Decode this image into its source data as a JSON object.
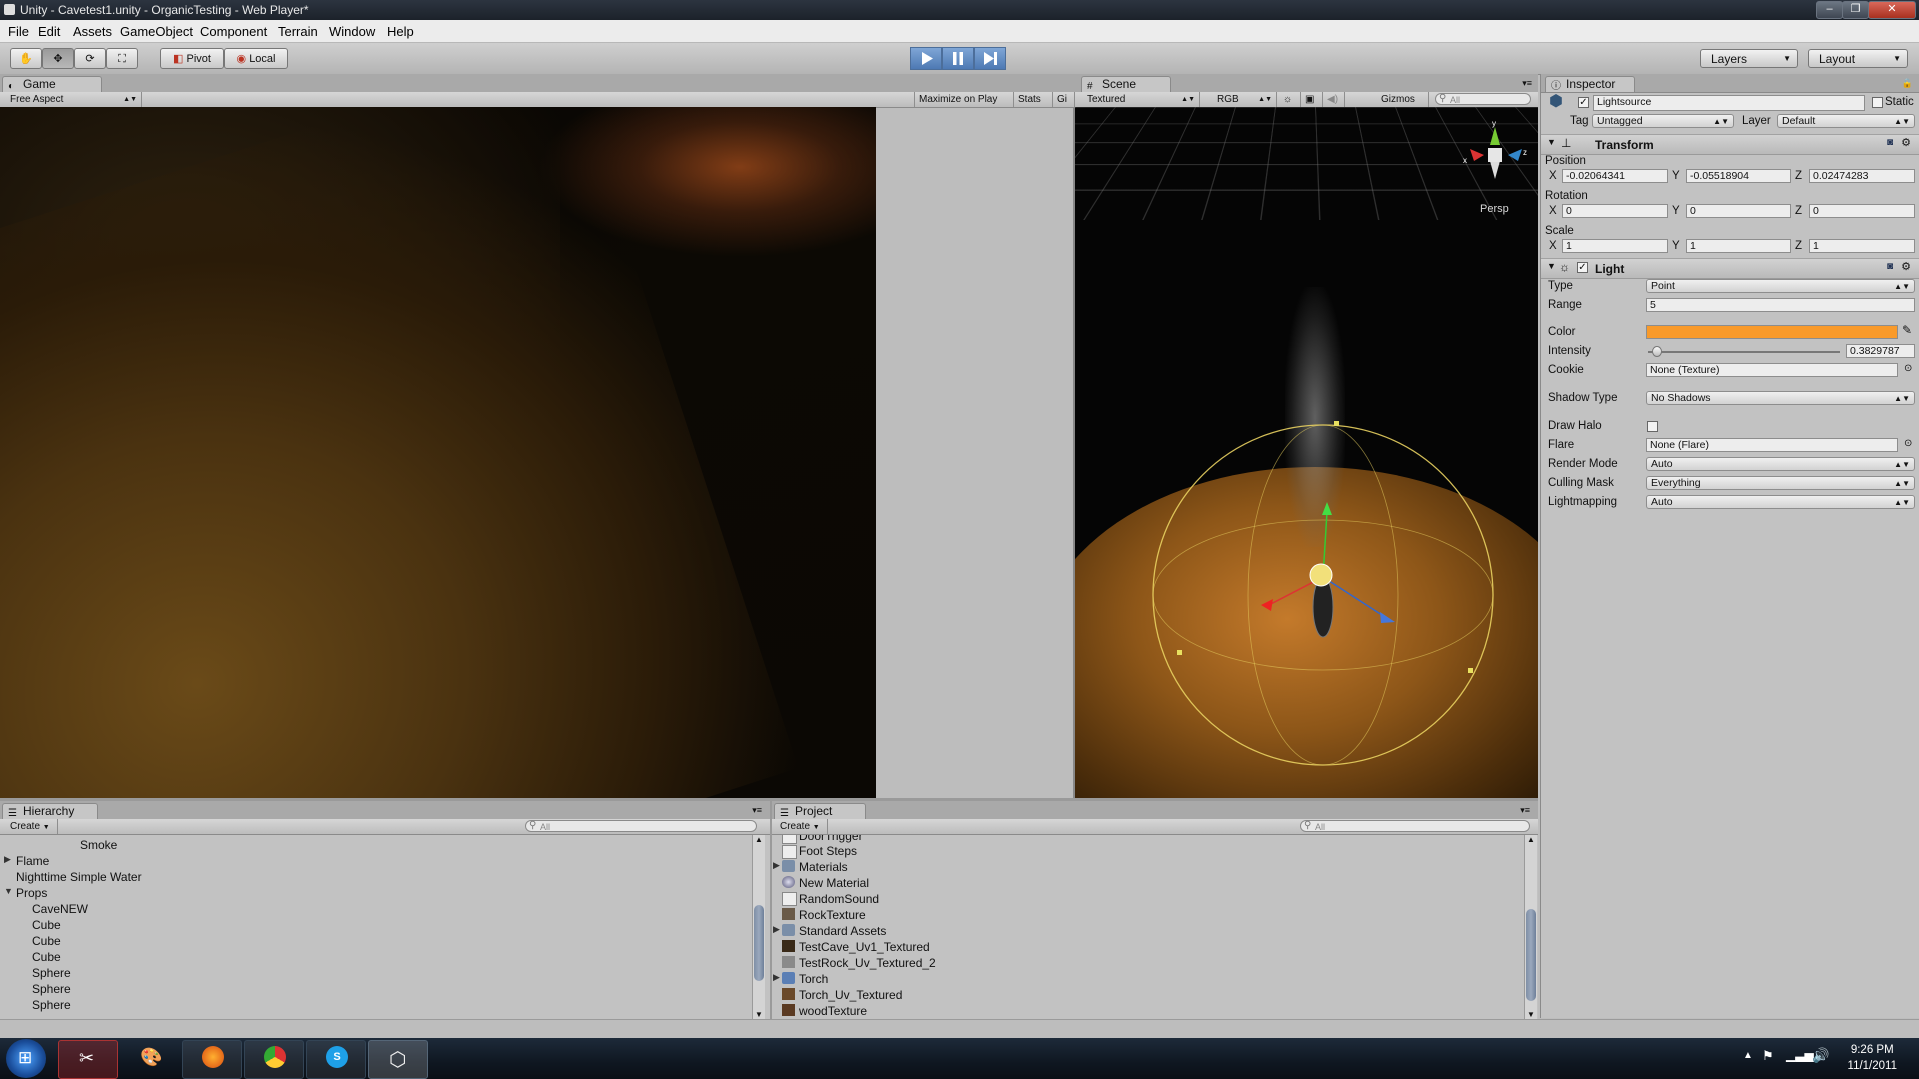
{
  "window": {
    "title": "Unity - Cavetest1.unity - OrganicTesting - Web Player*"
  },
  "menu": [
    "File",
    "Edit",
    "Assets",
    "GameObject",
    "Component",
    "Terrain",
    "Window",
    "Help"
  ],
  "toolbar": {
    "pivot": "Pivot",
    "local": "Local",
    "layers": "Layers",
    "layout": "Layout"
  },
  "game": {
    "tab": "Game",
    "aspect": "Free Aspect",
    "maximize": "Maximize on Play",
    "stats": "Stats",
    "gizmos": "Gi"
  },
  "scene": {
    "tab": "Scene",
    "render_mode": "Textured",
    "channel": "RGB",
    "gizmos": "Gizmos",
    "search_placeholder": "All",
    "persp": "Persp"
  },
  "inspector": {
    "tab": "Inspector",
    "object_name": "Lightsource",
    "static_label": "Static",
    "tag_label": "Tag",
    "tag_value": "Untagged",
    "layer_label": "Layer",
    "layer_value": "Default",
    "transform": {
      "title": "Transform",
      "position_label": "Position",
      "rotation_label": "Rotation",
      "scale_label": "Scale",
      "axis_x": "X",
      "axis_y": "Y",
      "axis_z": "Z",
      "position": {
        "x": "-0.02064341",
        "y": "-0.05518904",
        "z": "0.02474283"
      },
      "rotation": {
        "x": "0",
        "y": "0",
        "z": "0"
      },
      "scale": {
        "x": "1",
        "y": "1",
        "z": "1"
      }
    },
    "light": {
      "title": "Light",
      "type_label": "Type",
      "type_value": "Point",
      "range_label": "Range",
      "range_value": "5",
      "color_label": "Color",
      "color_value": "#f99a2a",
      "intensity_label": "Intensity",
      "intensity_value": "0.3829787",
      "intensity_fraction": 0.0479,
      "cookie_label": "Cookie",
      "cookie_value": "None (Texture)",
      "shadow_label": "Shadow Type",
      "shadow_value": "No Shadows",
      "halo_label": "Draw Halo",
      "flare_label": "Flare",
      "flare_value": "None (Flare)",
      "render_label": "Render Mode",
      "render_value": "Auto",
      "culling_label": "Culling Mask",
      "culling_value": "Everything",
      "lightmap_label": "Lightmapping",
      "lightmap_value": "Auto"
    }
  },
  "hierarchy": {
    "tab": "Hierarchy",
    "create": "Create",
    "search_placeholder": "All",
    "items": [
      {
        "label": "Smoke"
      },
      {
        "label": "Flame"
      },
      {
        "label": "Nighttime Simple Water"
      },
      {
        "label": "Props"
      },
      {
        "label": "CaveNEW"
      },
      {
        "label": "Cube"
      },
      {
        "label": "Cube"
      },
      {
        "label": "Cube"
      },
      {
        "label": "Sphere"
      },
      {
        "label": "Sphere"
      },
      {
        "label": "Sphere"
      }
    ]
  },
  "project": {
    "tab": "Project",
    "create": "Create",
    "search_placeholder": "All",
    "items": [
      {
        "label": "DoorTrigger"
      },
      {
        "label": "Foot Steps"
      },
      {
        "label": "Materials"
      },
      {
        "label": "New Material"
      },
      {
        "label": "RandomSound"
      },
      {
        "label": "RockTexture"
      },
      {
        "label": "Standard Assets"
      },
      {
        "label": "TestCave_Uv1_Textured"
      },
      {
        "label": "TestRock_Uv_Textured_2"
      },
      {
        "label": "Torch"
      },
      {
        "label": "Torch_Uv_Textured"
      },
      {
        "label": "woodTexture"
      }
    ]
  },
  "taskbar": {
    "time": "9:26 PM",
    "date": "11/1/2011"
  }
}
